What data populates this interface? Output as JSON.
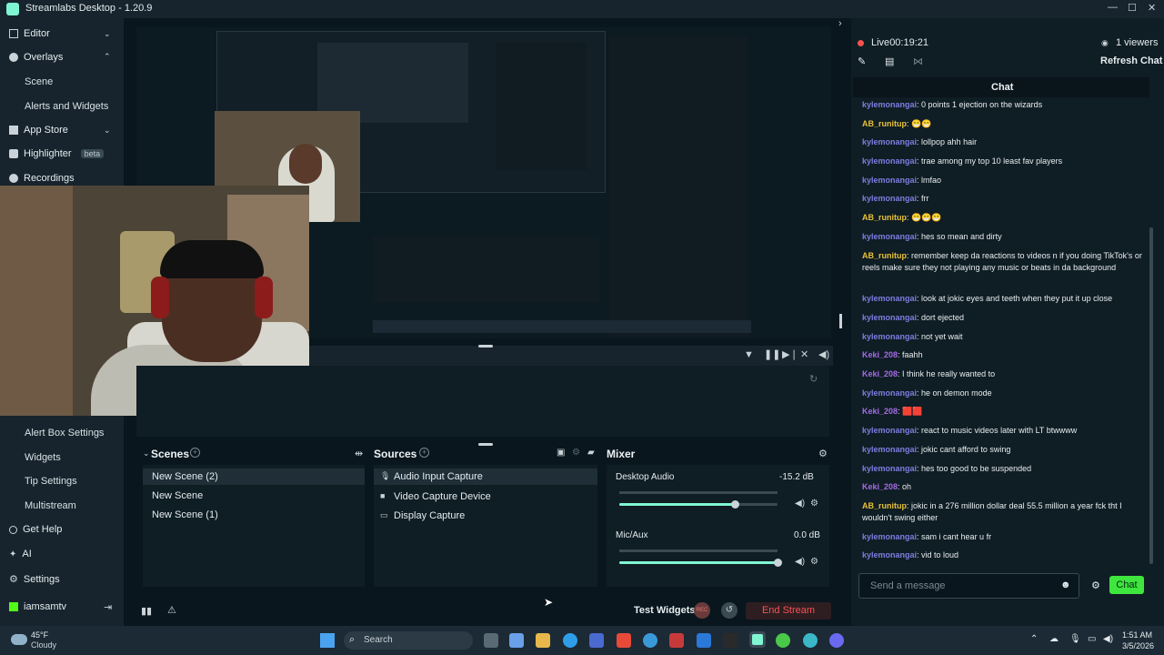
{
  "window": {
    "title": "Streamlabs Desktop - 1.20.9",
    "minimize": "—",
    "maximize": "☐",
    "close": "✕"
  },
  "sidebar": {
    "editor": "Editor",
    "overlays": "Overlays",
    "scene": "Scene",
    "alerts_widgets": "Alerts and Widgets",
    "app_store": "App Store",
    "highlighter": "Highlighter",
    "beta": "beta",
    "recordings": "Recordings",
    "alert_box_settings": "Alert Box Settings",
    "widgets": "Widgets",
    "tip_settings": "Tip Settings",
    "multistream": "Multistream",
    "get_help": "Get Help",
    "ai": "AI",
    "settings": "Settings",
    "user": "iamsamtv"
  },
  "scenes": {
    "title": "Scenes",
    "items": [
      "New Scene (2)",
      "New Scene",
      "New Scene (1)"
    ]
  },
  "sources": {
    "title": "Sources",
    "items": [
      "Audio Input Capture",
      "Video Capture Device",
      "Display Capture"
    ]
  },
  "mixer": {
    "title": "Mixer",
    "channels": [
      {
        "name": "Desktop Audio",
        "db": "-15.2 dB",
        "level": 0.73
      },
      {
        "name": "Mic/Aux",
        "db": "0.0 dB",
        "level": 1.0
      }
    ]
  },
  "bottombar": {
    "test_widgets": "Test Widgets",
    "rec": "REC",
    "end_stream": "End Stream"
  },
  "live": {
    "status": "Live",
    "time": "00:19:21",
    "viewers": "1 viewers",
    "refresh_chat": "Refresh Chat",
    "chat_tab": "Chat"
  },
  "chat": {
    "messages": [
      {
        "user": "kylemonangai",
        "text": ": 0 points 1 ejection on the wizards",
        "kind": "a"
      },
      {
        "user": "AB_runitup",
        "text": ": 😁😁",
        "kind": "b"
      },
      {
        "user": "kylemonangai",
        "text": ": lollpop ahh hair",
        "kind": "a"
      },
      {
        "user": "kylemonangai",
        "text": ": trae among my top 10 least fav players",
        "kind": "a"
      },
      {
        "user": "kylemonangai",
        "text": ": lmfao",
        "kind": "a"
      },
      {
        "user": "kylemonangai",
        "text": ": frr",
        "kind": "a"
      },
      {
        "user": "AB_runitup",
        "text": ": 😁😁😁",
        "kind": "b"
      },
      {
        "user": "kylemonangai",
        "text": ": hes so mean and dirty",
        "kind": "a"
      },
      {
        "user": "AB_runitup",
        "text": ": remember keep da reactions to videos n if you doing TikTok's or reels make sure they not playing any music or beats in da background",
        "kind": "b"
      },
      {
        "user": "kylemonangai",
        "text": ": look at jokic eyes and teeth when they put it up close",
        "kind": "a"
      },
      {
        "user": "kylemonangai",
        "text": ": dort ejected",
        "kind": "a"
      },
      {
        "user": "kylemonangai",
        "text": ": not yet wait",
        "kind": "a"
      },
      {
        "user": "Keki_208",
        "text": ": faahh",
        "kind": "k"
      },
      {
        "user": "Keki_208",
        "text": ": I think he really wanted to",
        "kind": "k"
      },
      {
        "user": "kylemonangai",
        "text": ": he on demon mode",
        "kind": "a"
      },
      {
        "user": "Keki_208",
        "text": ": 🟥🟥",
        "kind": "k"
      },
      {
        "user": "kylemonangai",
        "text": ": react to music videos later with LT btwwww",
        "kind": "a"
      },
      {
        "user": "kylemonangai",
        "text": ": jokic cant afford to swing",
        "kind": "a"
      },
      {
        "user": "kylemonangai",
        "text": ": hes too good to be suspended",
        "kind": "a"
      },
      {
        "user": "Keki_208",
        "text": ": oh",
        "kind": "k"
      },
      {
        "user": "AB_runitup",
        "text": ": jokic in a 276 million dollar deal 55.5 million a year fck tht I wouldn't swing either",
        "kind": "b"
      },
      {
        "user": "kylemonangai",
        "text": ": sam i cant hear u fr",
        "kind": "a"
      },
      {
        "user": "kylemonangai",
        "text": ": vid to loud",
        "kind": "a"
      }
    ],
    "input_placeholder": "Send a message",
    "send_button": "Chat"
  },
  "taskbar": {
    "temp": "45°F",
    "weather": "Cloudy",
    "search": "Search",
    "time": "1:51 AM",
    "date": "3/5/2026"
  },
  "colors": {
    "accent": "#80f5d2",
    "live": "#f85151",
    "send": "#3ee63e",
    "end_stream": "#a23a3a"
  }
}
